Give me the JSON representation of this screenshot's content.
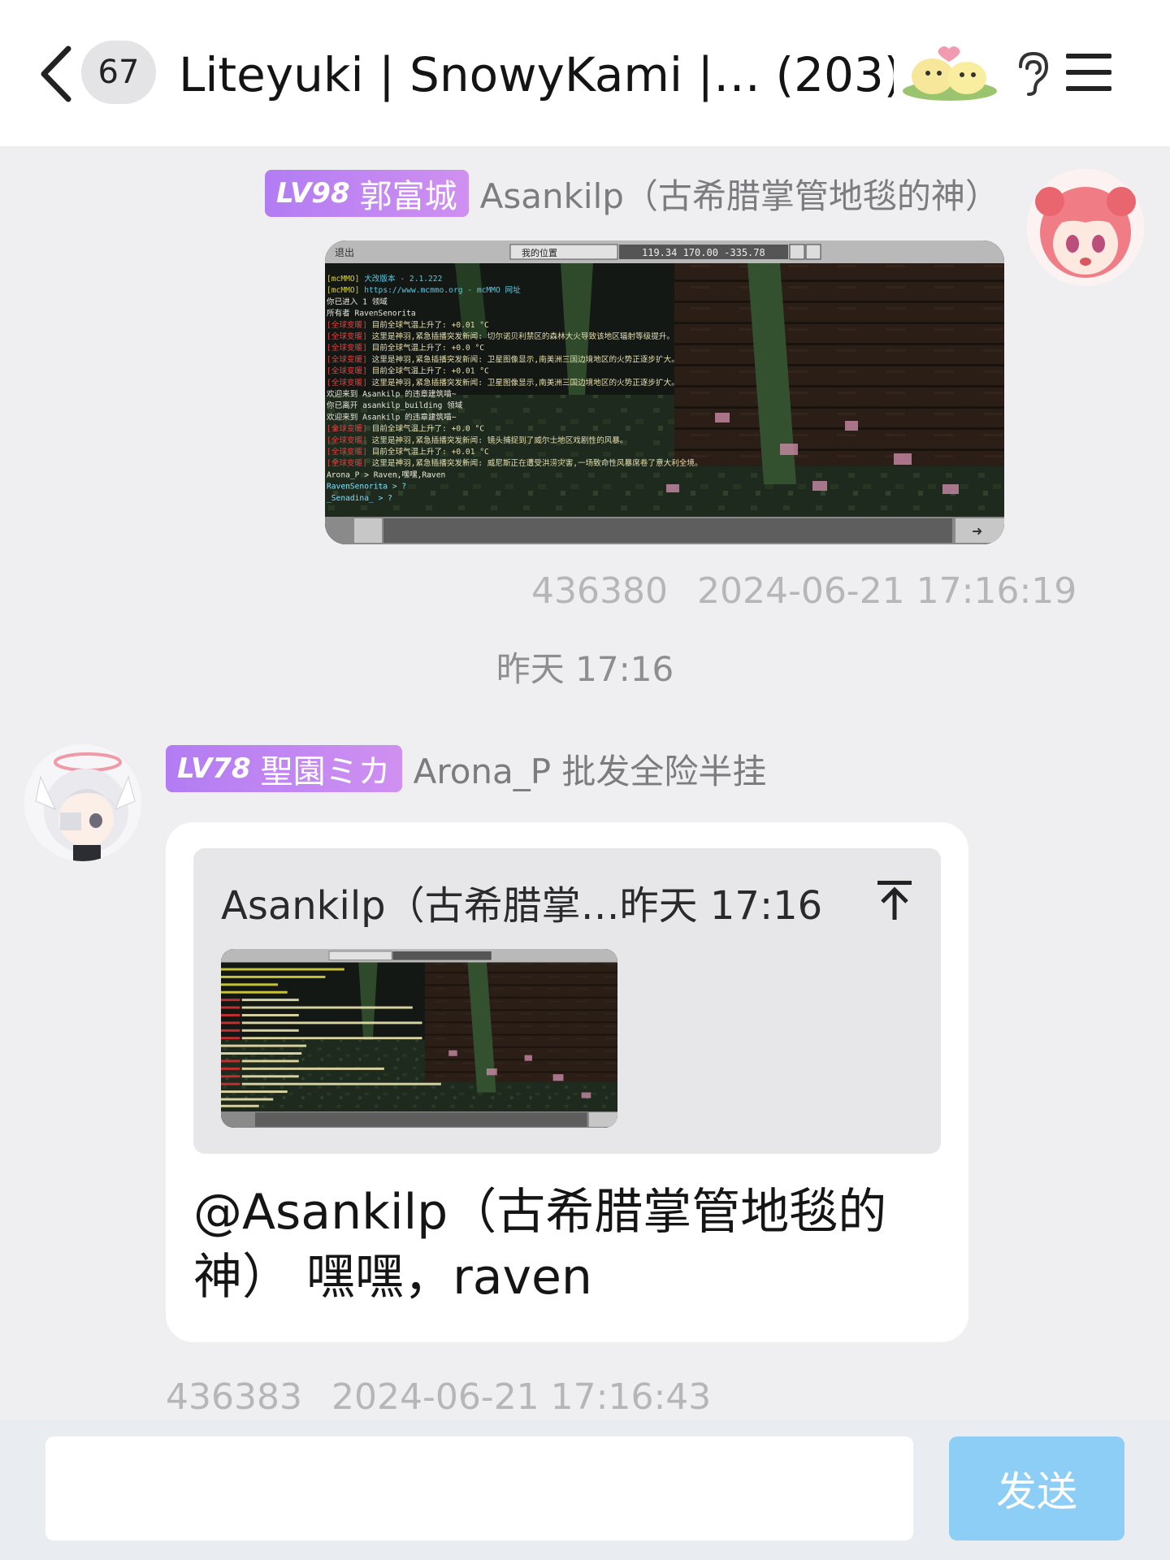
{
  "header": {
    "unread_count": "67",
    "title": "Liteyuki | SnowyKami |…  (203)"
  },
  "messages": [
    {
      "level": "LV98",
      "title": "郭富城",
      "sender": "Asankilp（古希腊掌管地毯的神）",
      "meta_id": "436380",
      "meta_time": "2024-06-21 17:16:19",
      "screenshot": {
        "exit_label": "退出",
        "location_select": "我的位置",
        "coords": "119.34 170.00 -335.78",
        "chat_lines": [
          "[mcMMO] 大改版本 - 2.1.222",
          "[mcMMO] https://www.mcmmo.org - mcMMO 网址",
          "你已进入 1 领域",
          "所有者 RavenSenorita",
          "[全球变暖] 目前全球气温上升了: +0.01 °C",
          "[全球变暖] 这里是神羽,紧急插播突发新闻: 切尔诺贝利禁区的森林大火导致该地区辐射等级提升。",
          "[全球变暖] 目前全球气温上升了: +0.0 °C",
          "[全球变暖] 这里是神羽,紧急插播突发新闻: 卫星图像显示,南美洲三国边境地区的火势正逐步扩大。",
          "[全球变暖] 目前全球气温上升了: +0.01 °C",
          "[全球变暖] 这里是神羽,紧急插播突发新闻: 卫星图像显示,南美洲三国边境地区的火势正逐步扩大。",
          "欢迎来到 Asankilp 的违章建筑喵~",
          "你已离开 asankilp_building 领域",
          "欢迎来到 Asankilp 的违章建筑喵~",
          "[全球变暖] 目前全球气温上升了: +0.0 °C",
          "[全球变暖] 这里是神羽,紧急插播突发新闻: 镜头捕捉到了威尔士地区戏剧性的风暴。",
          "[全球变暖] 目前全球气温上升了: +0.01 °C",
          "[全球变暖] 这里是神羽,紧急插播突发新闻: 威尼斯正在遭受洪涝灾害,一场致命性风暴席卷了意大利全境。",
          "Arona_P > Raven,嘿嘿,Raven",
          "RavenSenorita > ?",
          "_Senadina_ > ?"
        ]
      }
    },
    {
      "level": "LV78",
      "title": "聖園ミカ",
      "sender": "Arona_P 批发全险半挂",
      "quote_head": "Asankilp（古希腊掌…昨天 17:16",
      "mention": "@Asankilp（古希腊掌管地毯的神）",
      "text": " 嘿嘿，raven",
      "meta_id": "436383",
      "meta_time": "2024-06-21 17:16:43"
    }
  ],
  "time_separator": "昨天 17:16",
  "input": {
    "placeholder": "",
    "send_label": "发送"
  },
  "colors": {
    "accent_send": "#8ccef5",
    "level_tag": "#b27cf3",
    "background": "#efeff1"
  }
}
